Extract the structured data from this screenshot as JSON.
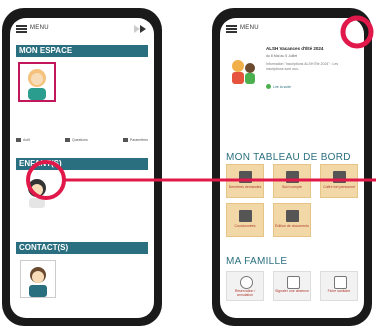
{
  "left_phone": {
    "menu_label": "MENU",
    "sections": {
      "mon_espace": "MON ESPACE",
      "enfants": "ENFANT(S)",
      "contacts": "CONTACT(S)"
    },
    "buttons": [
      "Actif",
      "Questions",
      "Paramètres"
    ]
  },
  "right_phone": {
    "menu_label": "MENU",
    "news": {
      "title": "ALSH Vacances d'Été 2024",
      "dates": "du 8 Mai au 5 Juillet",
      "body": "Information \"Inscriptions ALSH Été 2024\" : Les inscriptions sont ouv...",
      "link": "Lire la suite"
    },
    "dashboard_title": "MON TABLEAU DE BORD",
    "tiles": [
      "Dernières demandes",
      "Suivi compte",
      "Coffre fort personnel",
      "Coordonnées",
      "Édition de documents"
    ],
    "famille_title": "MA FAMILLE",
    "famille_tiles": [
      "Réservation / annulation",
      "Signaler une absence",
      "Fiche sanitaire"
    ]
  },
  "colors": {
    "accent": "#2a6f7f",
    "tile": "#f2d8a6",
    "highlight": "#e0194a"
  }
}
